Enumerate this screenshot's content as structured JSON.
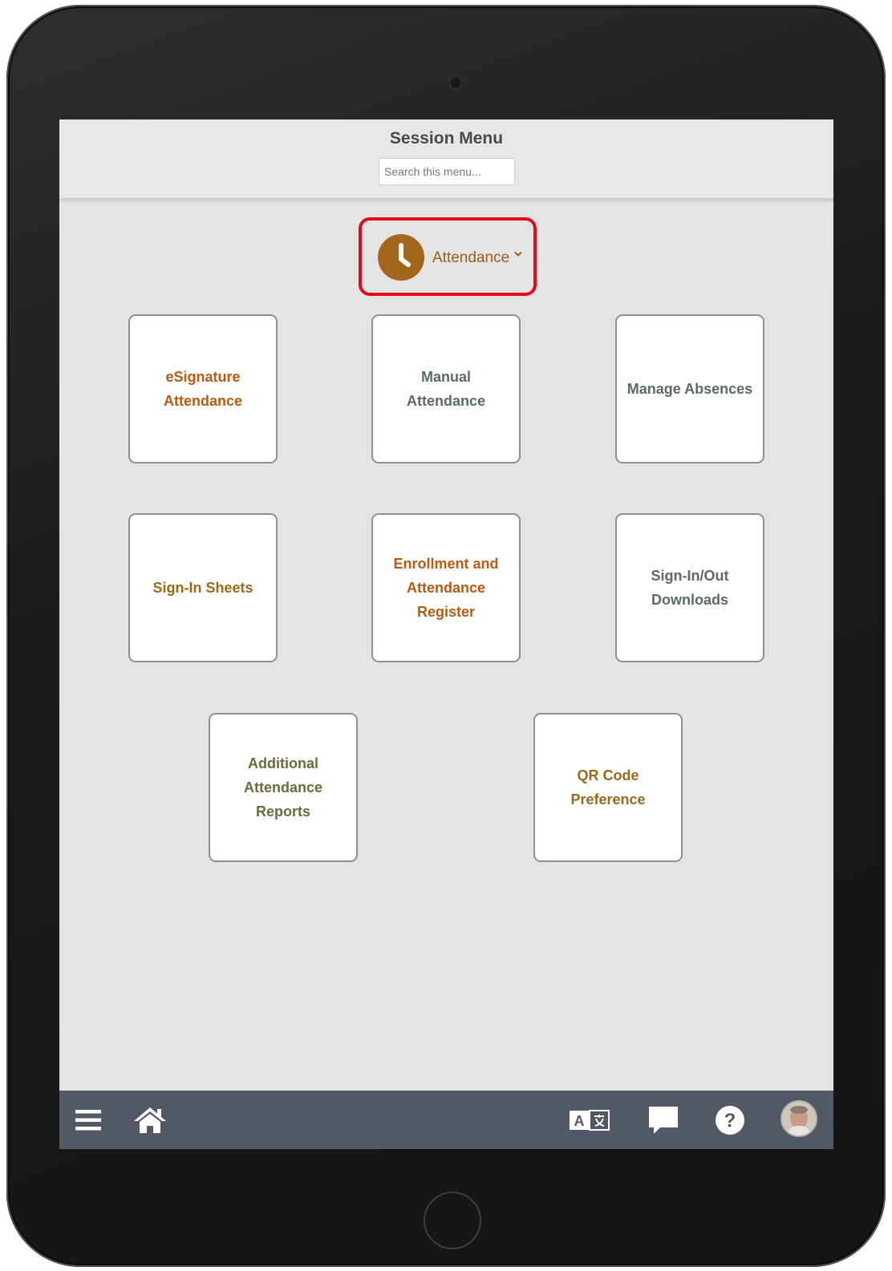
{
  "header": {
    "title": "Session Menu",
    "search_placeholder": "Search this menu..."
  },
  "category": {
    "label": "Attendance",
    "icon": "clock-icon",
    "highlight_color": "#e50914"
  },
  "tiles": [
    {
      "label": "eSignature Attendance",
      "color": "#b85a12"
    },
    {
      "label": "Manual Attendance",
      "color": "#5b6b63"
    },
    {
      "label": "Manage Absences",
      "color": "#5b6b63"
    },
    {
      "label": "Sign-In Sheets",
      "color": "#9a6a1a"
    },
    {
      "label": "Enrollment and Attendance Register",
      "color": "#b85a12"
    },
    {
      "label": "Sign-In/Out Downloads",
      "color": "#5b6b63"
    },
    {
      "label": "Additional Attendance Reports",
      "color": "#6b6a3a"
    },
    {
      "label": "QR Code Preference",
      "color": "#9a6a1a"
    }
  ],
  "bottom_bar": {
    "items": [
      "menu-icon",
      "home-icon",
      "translate-icon",
      "chat-icon",
      "help-icon",
      "avatar"
    ],
    "background": "#525866"
  }
}
